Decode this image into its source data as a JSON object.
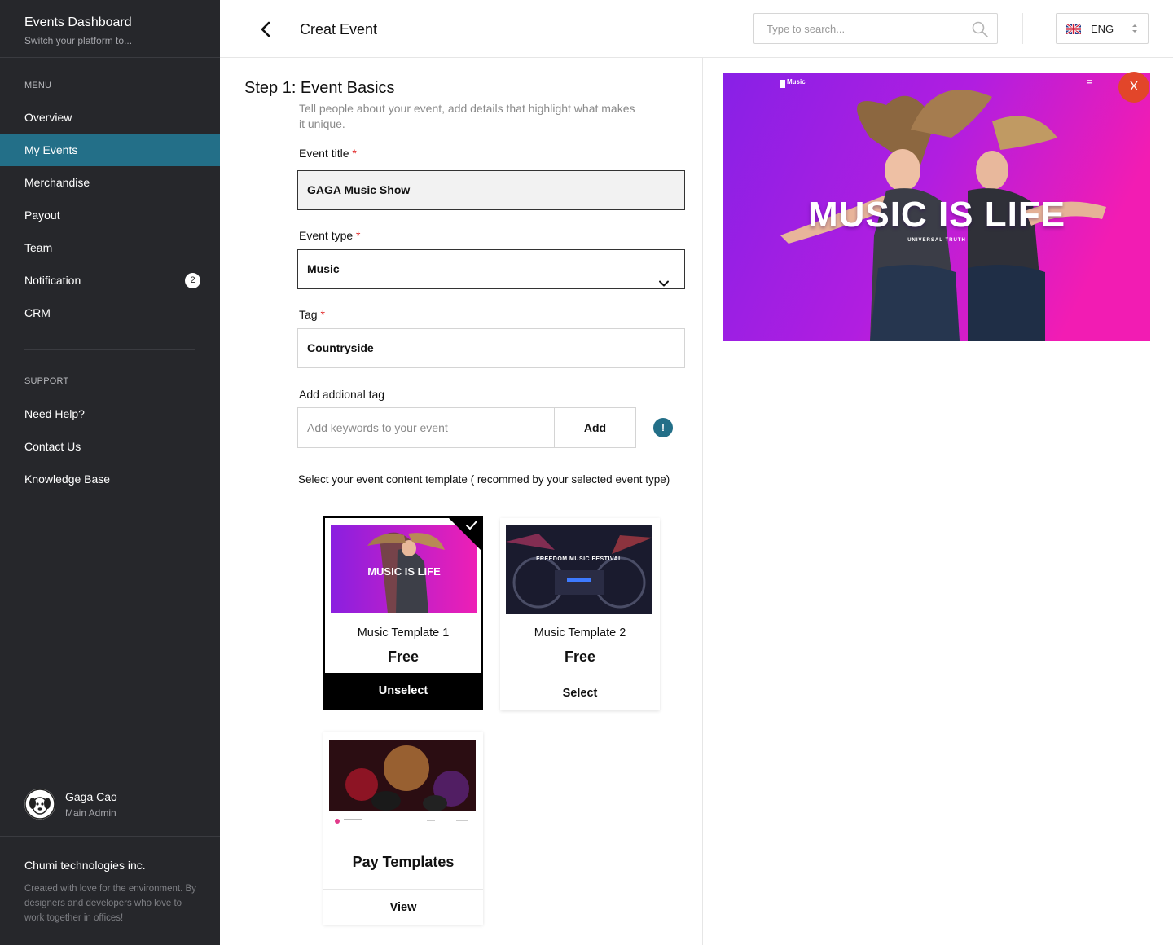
{
  "sidebar": {
    "brand_title": "Events Dashboard",
    "brand_subtitle": "Switch your platform to...",
    "menu_heading": "MENU",
    "menu_items": [
      {
        "label": "Overview"
      },
      {
        "label": "My Events",
        "active": true
      },
      {
        "label": "Merchandise"
      },
      {
        "label": "Payout"
      },
      {
        "label": "Team"
      },
      {
        "label": "Notification",
        "badge": "2"
      },
      {
        "label": "CRM"
      }
    ],
    "support_heading": "SUPPORT",
    "support_items": [
      {
        "label": "Need Help?"
      },
      {
        "label": "Contact Us"
      },
      {
        "label": "Knowledge Base"
      }
    ],
    "user": {
      "name": "Gaga Cao",
      "role": "Main Admin"
    },
    "company": "Chumi technologies inc.",
    "company_note": "Created with love for the environment. By designers and developers who love to work together in offices!",
    "active_color": "#236f88"
  },
  "header": {
    "title": "Creat Event",
    "search_placeholder": "Type to search...",
    "language": "ENG"
  },
  "form": {
    "step_title": "Step 1: Event Basics",
    "step_description": "Tell people about your event, add details that highlight what makes it unique.",
    "event_title_label": "Event title",
    "event_title_value": "GAGA Music Show",
    "event_type_label": "Event type",
    "event_type_value": "Music",
    "tag_label": "Tag",
    "tag_value": "Countryside",
    "additional_tag_label": "Add addional tag",
    "additional_tag_placeholder": "Add keywords to your event",
    "add_button": "Add",
    "info_icon": "!",
    "required_mark": "*",
    "template_note": "Select your event content template ( recommed by your selected event type)"
  },
  "templates": [
    {
      "name": "Music Template 1",
      "price": "Free",
      "action": "Unselect",
      "selected": true,
      "thumb_title": "MUSIC IS LIFE"
    },
    {
      "name": "Music Template 2",
      "price": "Free",
      "action": "Select",
      "selected": false,
      "thumb_title": "FREEDOM MUSIC FESTIVAL"
    },
    {
      "name": "Pay Templates",
      "action": "View",
      "selected": false
    }
  ],
  "preview": {
    "headline": "MUSIC IS LIFE",
    "subheadline": "UNIVERSAL TRUTH",
    "logo_text": "Music",
    "close_label": "X",
    "close_color": "#e2462a"
  }
}
